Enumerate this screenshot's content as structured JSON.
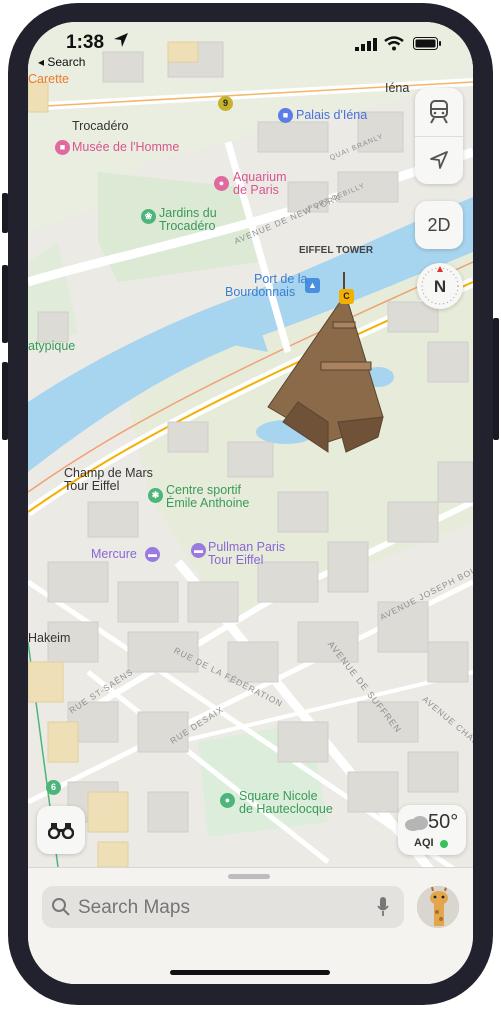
{
  "status_bar": {
    "time": "1:38",
    "back_label": "◂ Search"
  },
  "map": {
    "labels": {
      "carette": "Carette",
      "iena": "Iéna",
      "palais_iena": "Palais d'Iéna",
      "trocadero": "Trocadéro",
      "musee_homme": "Musée de l'Homme",
      "aquarium_1": "Aquarium",
      "aquarium_2": "de Paris",
      "jardins_1": "Jardins du",
      "jardins_2": "Trocadéro",
      "eiffel_tower": "EIFFEL TOWER",
      "port_1": "Port de la",
      "port_2": "Bourdonnais",
      "atypique": "atypique",
      "champ_1": "Champ de Mars",
      "champ_2": "Tour Eiffel",
      "centre_1": "Centre sportif",
      "centre_2": "Émile Anthoine",
      "mercure": "Mercure",
      "pullman_1": "Pullman Paris",
      "pullman_2": "Tour Eiffel",
      "hakeim": "Hakeim",
      "square_1": "Square Nicole",
      "square_2": "de Hauteclocque"
    },
    "streets": {
      "ny": "AVENUE DE NEW YORK",
      "debilly": "PORT DEBILLY",
      "branly": "QUAI BRANLY",
      "suffren": "AVENUE DE SUFFREN",
      "federation": "RUE DE LA FÉDÉRATION",
      "desaix": "RUE DESAIX",
      "saens": "RUE ST-SAËNS",
      "bouvard": "AVENUE JOSEPH BOUVARD",
      "charles": "AVENUE CHARLES"
    },
    "badges": {
      "metro_9": "9",
      "rer_c": "C",
      "metro_6": "6"
    }
  },
  "controls": {
    "view_2d": "2D",
    "compass": "N",
    "weather_temp": "50°",
    "aqi": "AQI"
  },
  "sheet": {
    "search_placeholder": "Search Maps"
  }
}
